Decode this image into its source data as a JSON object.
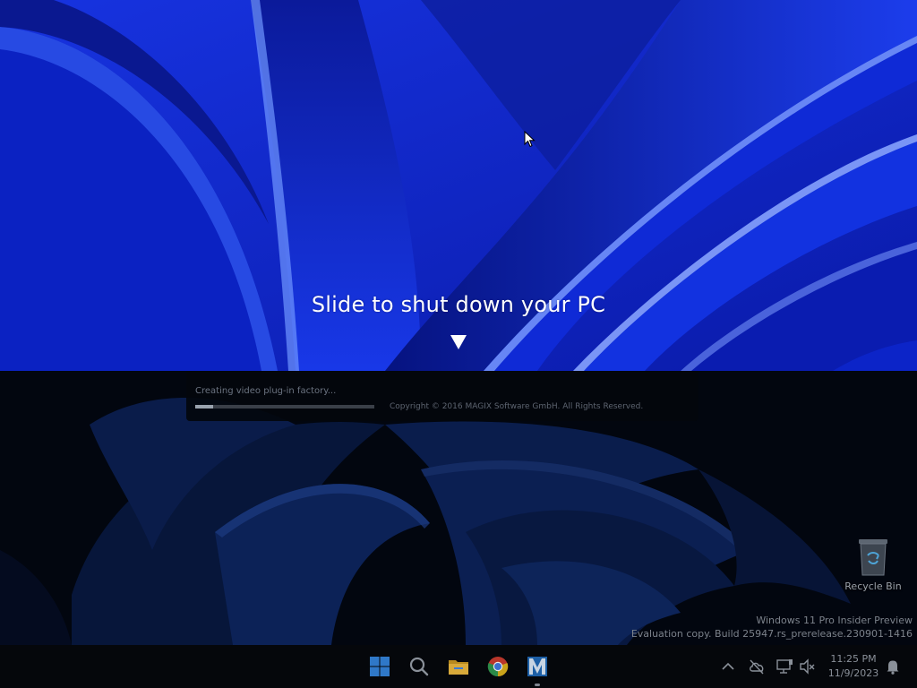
{
  "shutdown_overlay": {
    "message": "Slide to shut down your PC"
  },
  "splash": {
    "status_text": "Creating video plug-in factory...",
    "progress_fraction": 0.1,
    "copyright": "Copyright © 2016 MAGIX Software GmbH. All Rights Reserved."
  },
  "desktop": {
    "icons": [
      {
        "label": "Recycle Bin",
        "icon": "recycle-bin-icon"
      }
    ],
    "watermark": {
      "line1": "Windows 11 Pro Insider Preview",
      "line2": "Evaluation copy. Build 25947.rs_prerelease.230901-1416"
    }
  },
  "taskbar": {
    "pinned": [
      {
        "name": "start-button",
        "icon": "windows-logo-icon"
      },
      {
        "name": "search-button",
        "icon": "search-icon"
      },
      {
        "name": "file-explorer-button",
        "icon": "folder-icon"
      },
      {
        "name": "chrome-button",
        "icon": "chrome-icon"
      },
      {
        "name": "magix-app-button",
        "icon": "magix-icon",
        "active": true
      }
    ],
    "tray": [
      {
        "name": "show-hidden-icons",
        "icon": "chevron-up-icon"
      },
      {
        "name": "network-status",
        "icon": "cloud-offline-icon"
      },
      {
        "name": "display-status",
        "icon": "monitor-icon"
      },
      {
        "name": "sound-muted",
        "icon": "speaker-muted-icon"
      },
      {
        "name": "notifications",
        "icon": "bell-icon"
      }
    ],
    "clock": {
      "time": "11:25 PM",
      "date": "11/9/2023"
    }
  },
  "colors": {
    "wallpaper_blue": "#0a1fbe",
    "taskbar_bg": "#05070b",
    "desktop_bg": "#02060f"
  }
}
